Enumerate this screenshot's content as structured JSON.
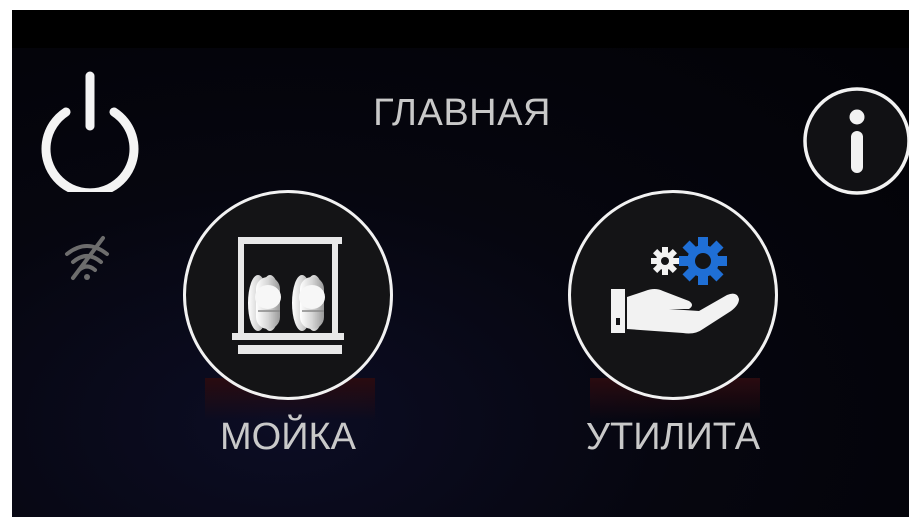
{
  "header": {
    "title": "ГЛАВНАЯ"
  },
  "icons": {
    "power": "power-icon",
    "info": "info-icon",
    "wifi": "wifi-off-icon",
    "dishwasher": "dishwasher-icon",
    "utility": "hand-gears-icon"
  },
  "main": {
    "tiles": [
      {
        "label": "МОЙКА"
      },
      {
        "label": "УТИЛИТА"
      }
    ]
  },
  "colors": {
    "background": "#05050c",
    "accent_blue": "#1f6fd6",
    "text": "#c9c9c9",
    "icon_white": "#f2f2f2"
  }
}
